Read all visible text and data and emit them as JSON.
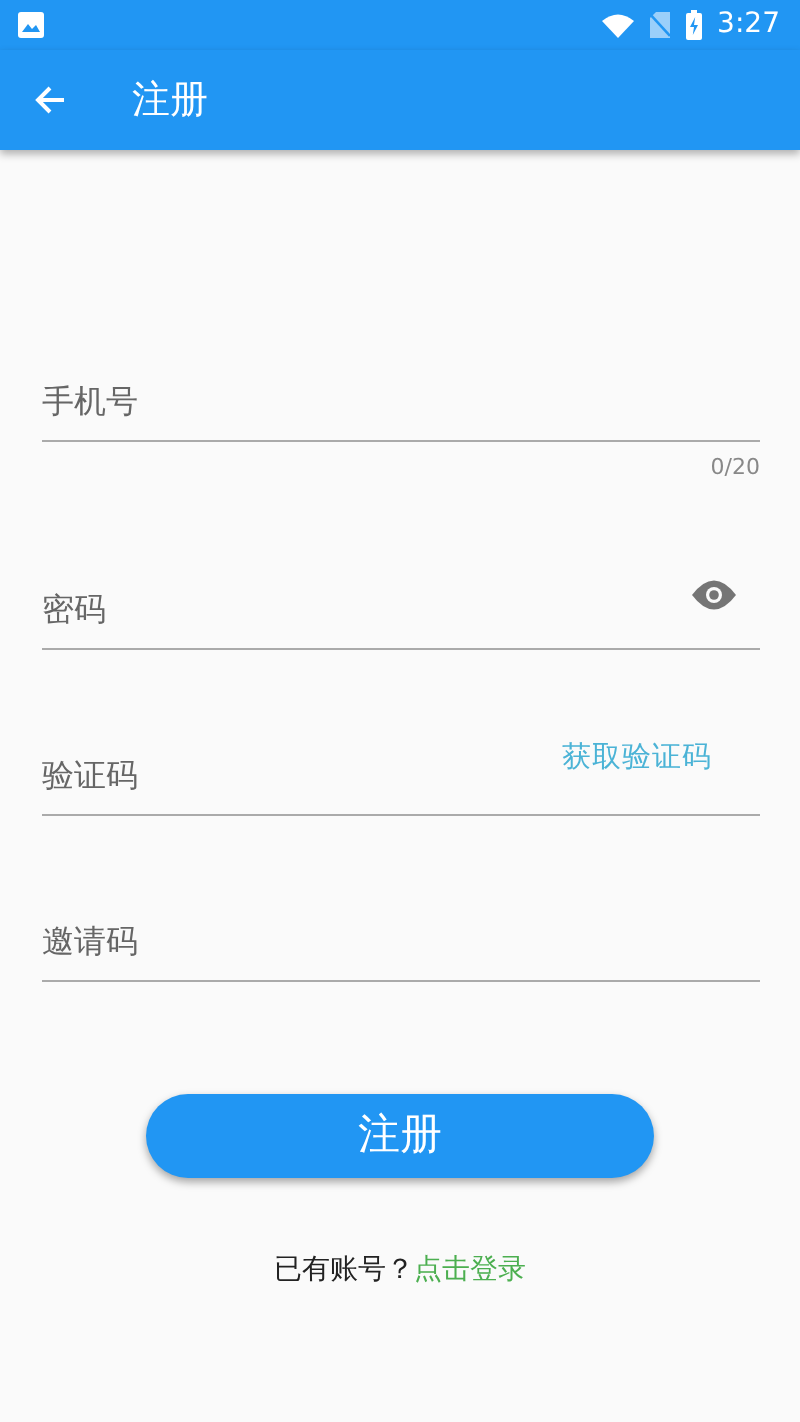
{
  "status_bar": {
    "time": "3:27"
  },
  "app_bar": {
    "title": "注册"
  },
  "fields": [
    {
      "kind": "counter",
      "placeholder": "手机号",
      "counter": "0/20"
    },
    {
      "kind": "password",
      "placeholder": "密码"
    },
    {
      "kind": "action",
      "placeholder": "验证码",
      "action": "获取验证码"
    },
    {
      "kind": "plain",
      "placeholder": "邀请码"
    }
  ],
  "submit_button": "注册",
  "footer": {
    "text": "已有账号？",
    "link": "点击登录"
  }
}
